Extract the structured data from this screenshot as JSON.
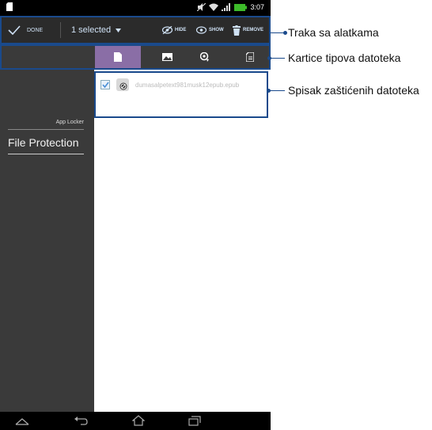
{
  "status_bar": {
    "time": "3:07",
    "icons": [
      "sim-card-icon",
      "mute-icon",
      "wifi-icon",
      "signal-icon",
      "battery-icon"
    ]
  },
  "toolbar": {
    "done_label": "DONE",
    "selection_label": "1 selected",
    "hide_label": "HIDE",
    "show_label": "SHOW",
    "remove_label": "REMOVE"
  },
  "tabs": [
    {
      "name": "documents",
      "icon": "document-icon",
      "selected": true
    },
    {
      "name": "images",
      "icon": "image-icon",
      "selected": false
    },
    {
      "name": "videos",
      "icon": "video-icon",
      "selected": false
    },
    {
      "name": "others",
      "icon": "other-file-icon",
      "selected": false
    }
  ],
  "sidebar": {
    "app_name": "App Locker",
    "active_item": "File Protection"
  },
  "files": [
    {
      "name": "dumasalpetext981musk12epub.epub",
      "checked": true
    }
  ],
  "callouts": {
    "toolbar": "Traka sa alatkama",
    "tabs": "Kartice tipova datoteka",
    "list": "Spisak zaštićenih datoteka"
  },
  "colors": {
    "accent": "#8a6ea6",
    "frame": "#1a4a8c",
    "checkbox": "#4a8fd6"
  }
}
